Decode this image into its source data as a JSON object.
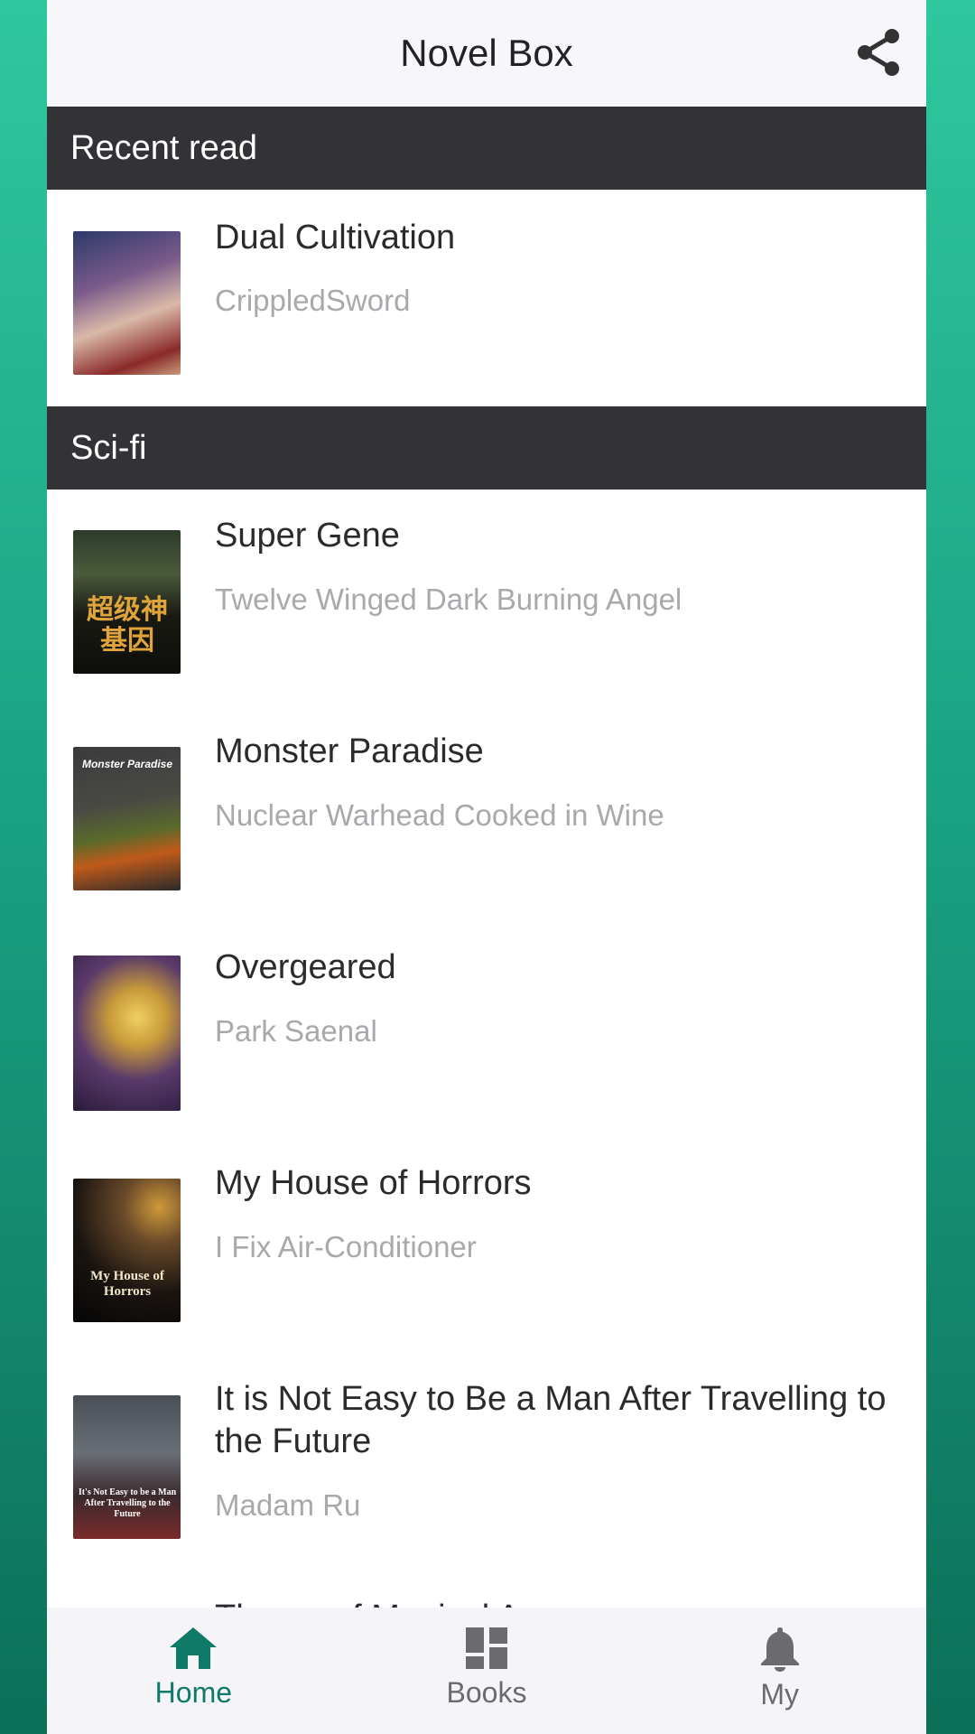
{
  "header": {
    "title": "Novel Box",
    "share_icon": "share-icon"
  },
  "sections": {
    "recent": {
      "label": "Recent read"
    },
    "scifi": {
      "label": "Sci-fi"
    }
  },
  "recent_items": [
    {
      "title": "Dual Cultivation",
      "author": "CrippledSword"
    }
  ],
  "scifi_items": [
    {
      "title": "Super Gene",
      "author": "Twelve Winged Dark Burning Angel",
      "cover_text": "超级神基因"
    },
    {
      "title": "Monster Paradise",
      "author": "Nuclear Warhead Cooked in Wine",
      "cover_text": "Monster Paradise"
    },
    {
      "title": "Overgeared",
      "author": "Park Saenal"
    },
    {
      "title": "My House of Horrors",
      "author": "I Fix Air-Conditioner",
      "cover_text": "My House of Horrors"
    },
    {
      "title": "It is Not Easy to Be a Man After Travelling to the Future",
      "author": "Madam Ru",
      "cover_text": "It's Not Easy to be a Man After Travelling to the Future"
    }
  ],
  "partial_item": {
    "title": "Throne of Magical A..."
  },
  "bottom_nav": [
    {
      "label": "Home",
      "icon": "home-icon",
      "active": true
    },
    {
      "label": "Books",
      "icon": "books-grid-icon",
      "active": false
    },
    {
      "label": "My",
      "icon": "bell-icon",
      "active": false
    }
  ],
  "colors": {
    "accent": "#0e7a67",
    "inactive": "#6b6b6f",
    "section_bg": "#333236"
  }
}
